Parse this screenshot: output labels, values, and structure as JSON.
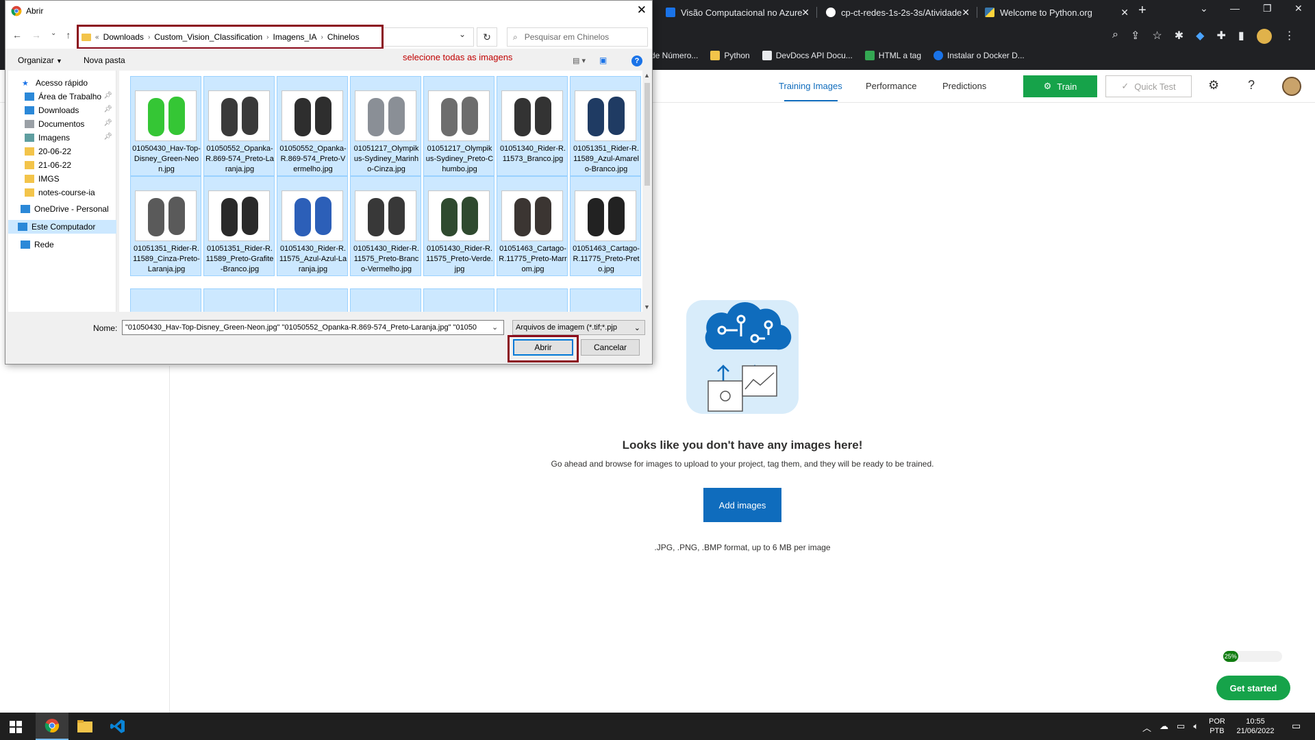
{
  "browser": {
    "tabs": [
      {
        "label": "Visão Computacional no Azure",
        "icon": "azure-tab-icon"
      },
      {
        "label": "cp-ct-redes-1s-2s-3s/Atividade",
        "icon": "github-tab-icon"
      },
      {
        "label": "Welcome to Python.org",
        "icon": "python-tab-icon"
      }
    ],
    "bookmarks": [
      "de Número...",
      "Python",
      "DevDocs API Docu...",
      "HTML a tag",
      "Instalar o Docker D..."
    ]
  },
  "custom_vision": {
    "tabs": [
      "Training Images",
      "Performance",
      "Predictions"
    ],
    "train_label": "Train",
    "quick_test_label": "Quick Test",
    "empty_title": "Looks like you don't have any images here!",
    "empty_subtitle": "Go ahead and browse for images to upload to your project, tag them, and they will be ready to be trained.",
    "add_images_label": "Add images",
    "formats_text": ".JPG, .PNG, .BMP format, up to 6 MB per image",
    "progress_label": "25%",
    "progress_value": 0.25,
    "get_started_label": "Get started",
    "accent_color": "#0f6cbd",
    "train_color": "#16a34a"
  },
  "dialog": {
    "title": "Abrir",
    "breadcrumb": [
      "Downloads",
      "Custom_Vision_Classification",
      "Imagens_IA",
      "Chinelos"
    ],
    "search_placeholder": "Pesquisar em Chinelos",
    "toolbar": {
      "organize": "Organizar",
      "new_folder": "Nova pasta"
    },
    "annotation": "selecione todas as imagens",
    "sidebar": [
      {
        "label": "Acesso rápido",
        "icon": "star-icon"
      },
      {
        "label": "Área de Trabalho",
        "icon": "desktop-icon"
      },
      {
        "label": "Downloads",
        "icon": "download-icon"
      },
      {
        "label": "Documentos",
        "icon": "document-icon"
      },
      {
        "label": "Imagens",
        "icon": "images-icon"
      },
      {
        "label": "20-06-22",
        "icon": "folder-icon"
      },
      {
        "label": "21-06-22",
        "icon": "folder-icon"
      },
      {
        "label": "IMGS",
        "icon": "folder-icon"
      },
      {
        "label": "notes-course-ia",
        "icon": "folder-icon"
      },
      {
        "label": "OneDrive - Personal",
        "icon": "cloud-icon"
      },
      {
        "label": "Este Computador",
        "icon": "computer-icon"
      },
      {
        "label": "Rede",
        "icon": "network-icon"
      }
    ],
    "files": [
      {
        "name": "01050430_Hav-Top-Disney_Green-Neon.jpg",
        "color": "#35c635"
      },
      {
        "name": "01050552_Opanka-R.869-574_Preto-Laranja.jpg",
        "color": "#3a3a3a"
      },
      {
        "name": "01050552_Opanka-R.869-574_Preto-Vermelho.jpg",
        "color": "#2e2e2e"
      },
      {
        "name": "01051217_Olympikus-Sydiney_Marinho-Cinza.jpg",
        "color": "#8a8f96"
      },
      {
        "name": "01051217_Olympikus-Sydiney_Preto-Chumbo.jpg",
        "color": "#6d6d6d"
      },
      {
        "name": "01051340_Rider-R.11573_Branco.jpg",
        "color": "#333333"
      },
      {
        "name": "01051351_Rider-R.11589_Azul-Amarelo-Branco.jpg",
        "color": "#1f3b63"
      },
      {
        "name": "01051351_Rider-R.11589_Cinza-Preto-Laranja.jpg",
        "color": "#5a5a5a"
      },
      {
        "name": "01051351_Rider-R.11589_Preto-Grafite-Branco.jpg",
        "color": "#2a2a2a"
      },
      {
        "name": "01051430_Rider-R.11575_Azul-Azul-Laranja.jpg",
        "color": "#2c5fb8"
      },
      {
        "name": "01051430_Rider-R.11575_Preto-Branco-Vermelho.jpg",
        "color": "#383838"
      },
      {
        "name": "01051430_Rider-R.11575_Preto-Verde.jpg",
        "color": "#2f4a2f"
      },
      {
        "name": "01051463_Cartago-R.11775_Preto-Marrom.jpg",
        "color": "#3b3532"
      },
      {
        "name": "01051463_Cartago-R.11775_Preto-Preto.jpg",
        "color": "#222222"
      }
    ],
    "name_label": "Nome:",
    "name_value": "\"01050430_Hav-Top-Disney_Green-Neon.jpg\" \"01050552_Opanka-R.869-574_Preto-Laranja.jpg\" \"01050",
    "filter_value": "Arquivos de imagem (*.tif;*.pjp",
    "open_label": "Abrir",
    "cancel_label": "Cancelar",
    "highlight_color": "#8b0a1a"
  },
  "taskbar": {
    "lang_top": "POR",
    "lang_bottom": "PTB",
    "time": "10:55",
    "date": "21/06/2022"
  }
}
